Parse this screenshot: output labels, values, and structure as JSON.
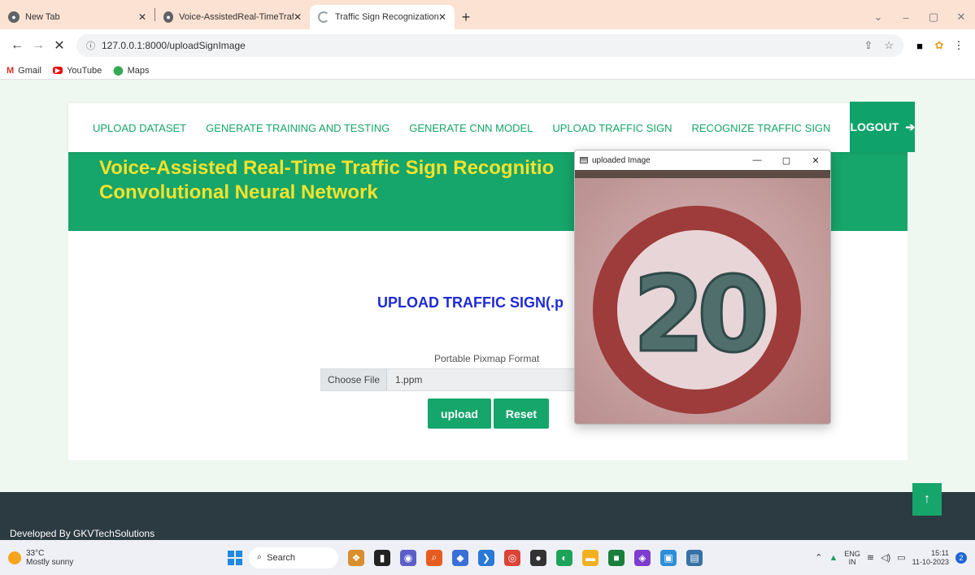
{
  "browser": {
    "tabs": [
      {
        "title": "New Tab",
        "icon": "chrome-icon"
      },
      {
        "title": "Voice-AssistedReal-TimeTrafficSi",
        "icon": "globe-icon"
      },
      {
        "title": "Traffic Sign Recognization",
        "icon": "loading-icon",
        "active": true
      }
    ],
    "new_tab_label": "+",
    "url": "127.0.0.1:8000/uploadSignImage",
    "bookmarks": [
      "Gmail",
      "YouTube",
      "Maps"
    ]
  },
  "nav": {
    "links": [
      "UPLOAD DATASET",
      "GENERATE TRAINING AND TESTING",
      "GENERATE CNN MODEL",
      "UPLOAD TRAFFIC SIGN",
      "RECOGNIZE TRAFFIC SIGN"
    ],
    "logout": "LOGOUT"
  },
  "hero": {
    "title": "Voice-Assisted Real-Time Traffic Sign Recognitio Convolutional Neural Network"
  },
  "form": {
    "heading": "UPLOAD TRAFFIC SIGN(.p",
    "format_label": "Portable Pixmap Format",
    "choose_file": "Choose File",
    "file_name": "1.ppm",
    "upload_button": "upload",
    "reset_button": "Reset"
  },
  "footer": {
    "text": "Developed By GKVTechSolutions"
  },
  "image_window": {
    "title": "uploaded Image",
    "sign_text": "20"
  },
  "taskbar": {
    "temperature": "33°C",
    "weather": "Mostly sunny",
    "search": "Search",
    "lang_top": "ENG",
    "lang_bottom": "IN",
    "time": "15:11",
    "date": "11-10-2023",
    "notifications": "2"
  },
  "colors": {
    "accent_green": "#16a56a",
    "hero_title": "#f5e22d",
    "heading_blue": "#1e2bd6",
    "footer_dark": "#2c3a41"
  }
}
